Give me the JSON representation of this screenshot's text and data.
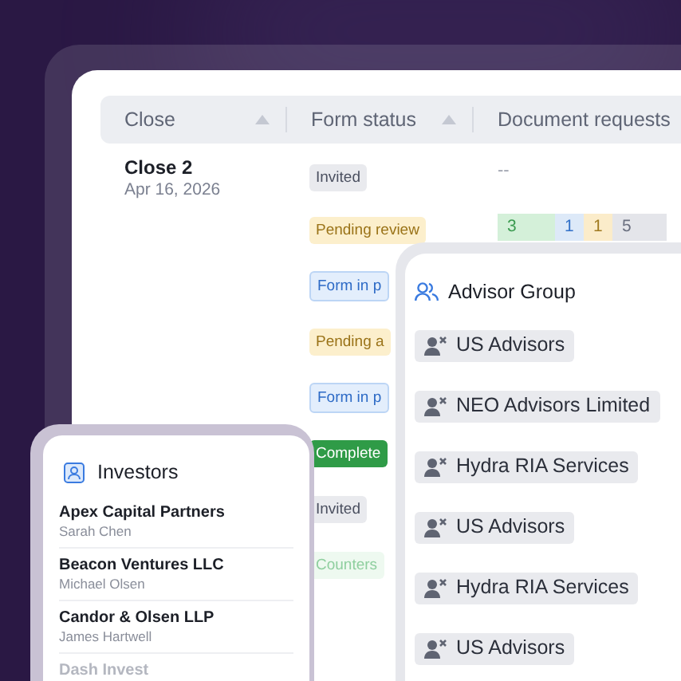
{
  "table": {
    "columns": [
      {
        "label": "Close",
        "sortable": true
      },
      {
        "label": "Form status",
        "sortable": true
      },
      {
        "label": "Document requests"
      }
    ],
    "rows": [
      {
        "close": "Close 2",
        "date": "Apr 16, 2026",
        "status": {
          "label": "Invited",
          "kind": "neutral"
        },
        "documents": {
          "empty": "--"
        }
      },
      {
        "status": {
          "label": "Pending review",
          "kind": "warning"
        },
        "documents": {
          "segments": [
            {
              "count": "3",
              "kind": "success"
            },
            {
              "count": "1",
              "kind": "info"
            },
            {
              "count": "1",
              "kind": "warning"
            },
            {
              "count": "5",
              "kind": "neutral"
            }
          ]
        }
      },
      {
        "status": {
          "label": "Form in p",
          "kind": "info"
        }
      },
      {
        "status": {
          "label": "Pending a",
          "kind": "warning"
        }
      },
      {
        "status": {
          "label": "Form in p",
          "kind": "info"
        }
      },
      {
        "status": {
          "label": "Complete",
          "kind": "solid-success"
        }
      },
      {
        "status": {
          "label": "Invited",
          "kind": "neutral"
        }
      },
      {
        "status": {
          "label": "Counters",
          "kind": "faded-success"
        }
      }
    ]
  },
  "advisor_group": {
    "title": "Advisor Group",
    "items": [
      "US Advisors",
      "NEO Advisors Limited",
      "Hydra RIA Services",
      "US Advisors",
      "Hydra RIA Services",
      "US Advisors"
    ]
  },
  "investors": {
    "title": "Investors",
    "items": [
      {
        "name": "Apex Capital Partners",
        "contact": "Sarah Chen",
        "faded": false
      },
      {
        "name": "Beacon Ventures LLC",
        "contact": "Michael Olsen",
        "faded": false
      },
      {
        "name": "Candor & Olsen LLP",
        "contact": "James Hartwell",
        "faded": false
      },
      {
        "name": "Dash Invest",
        "faded": true
      }
    ]
  }
}
